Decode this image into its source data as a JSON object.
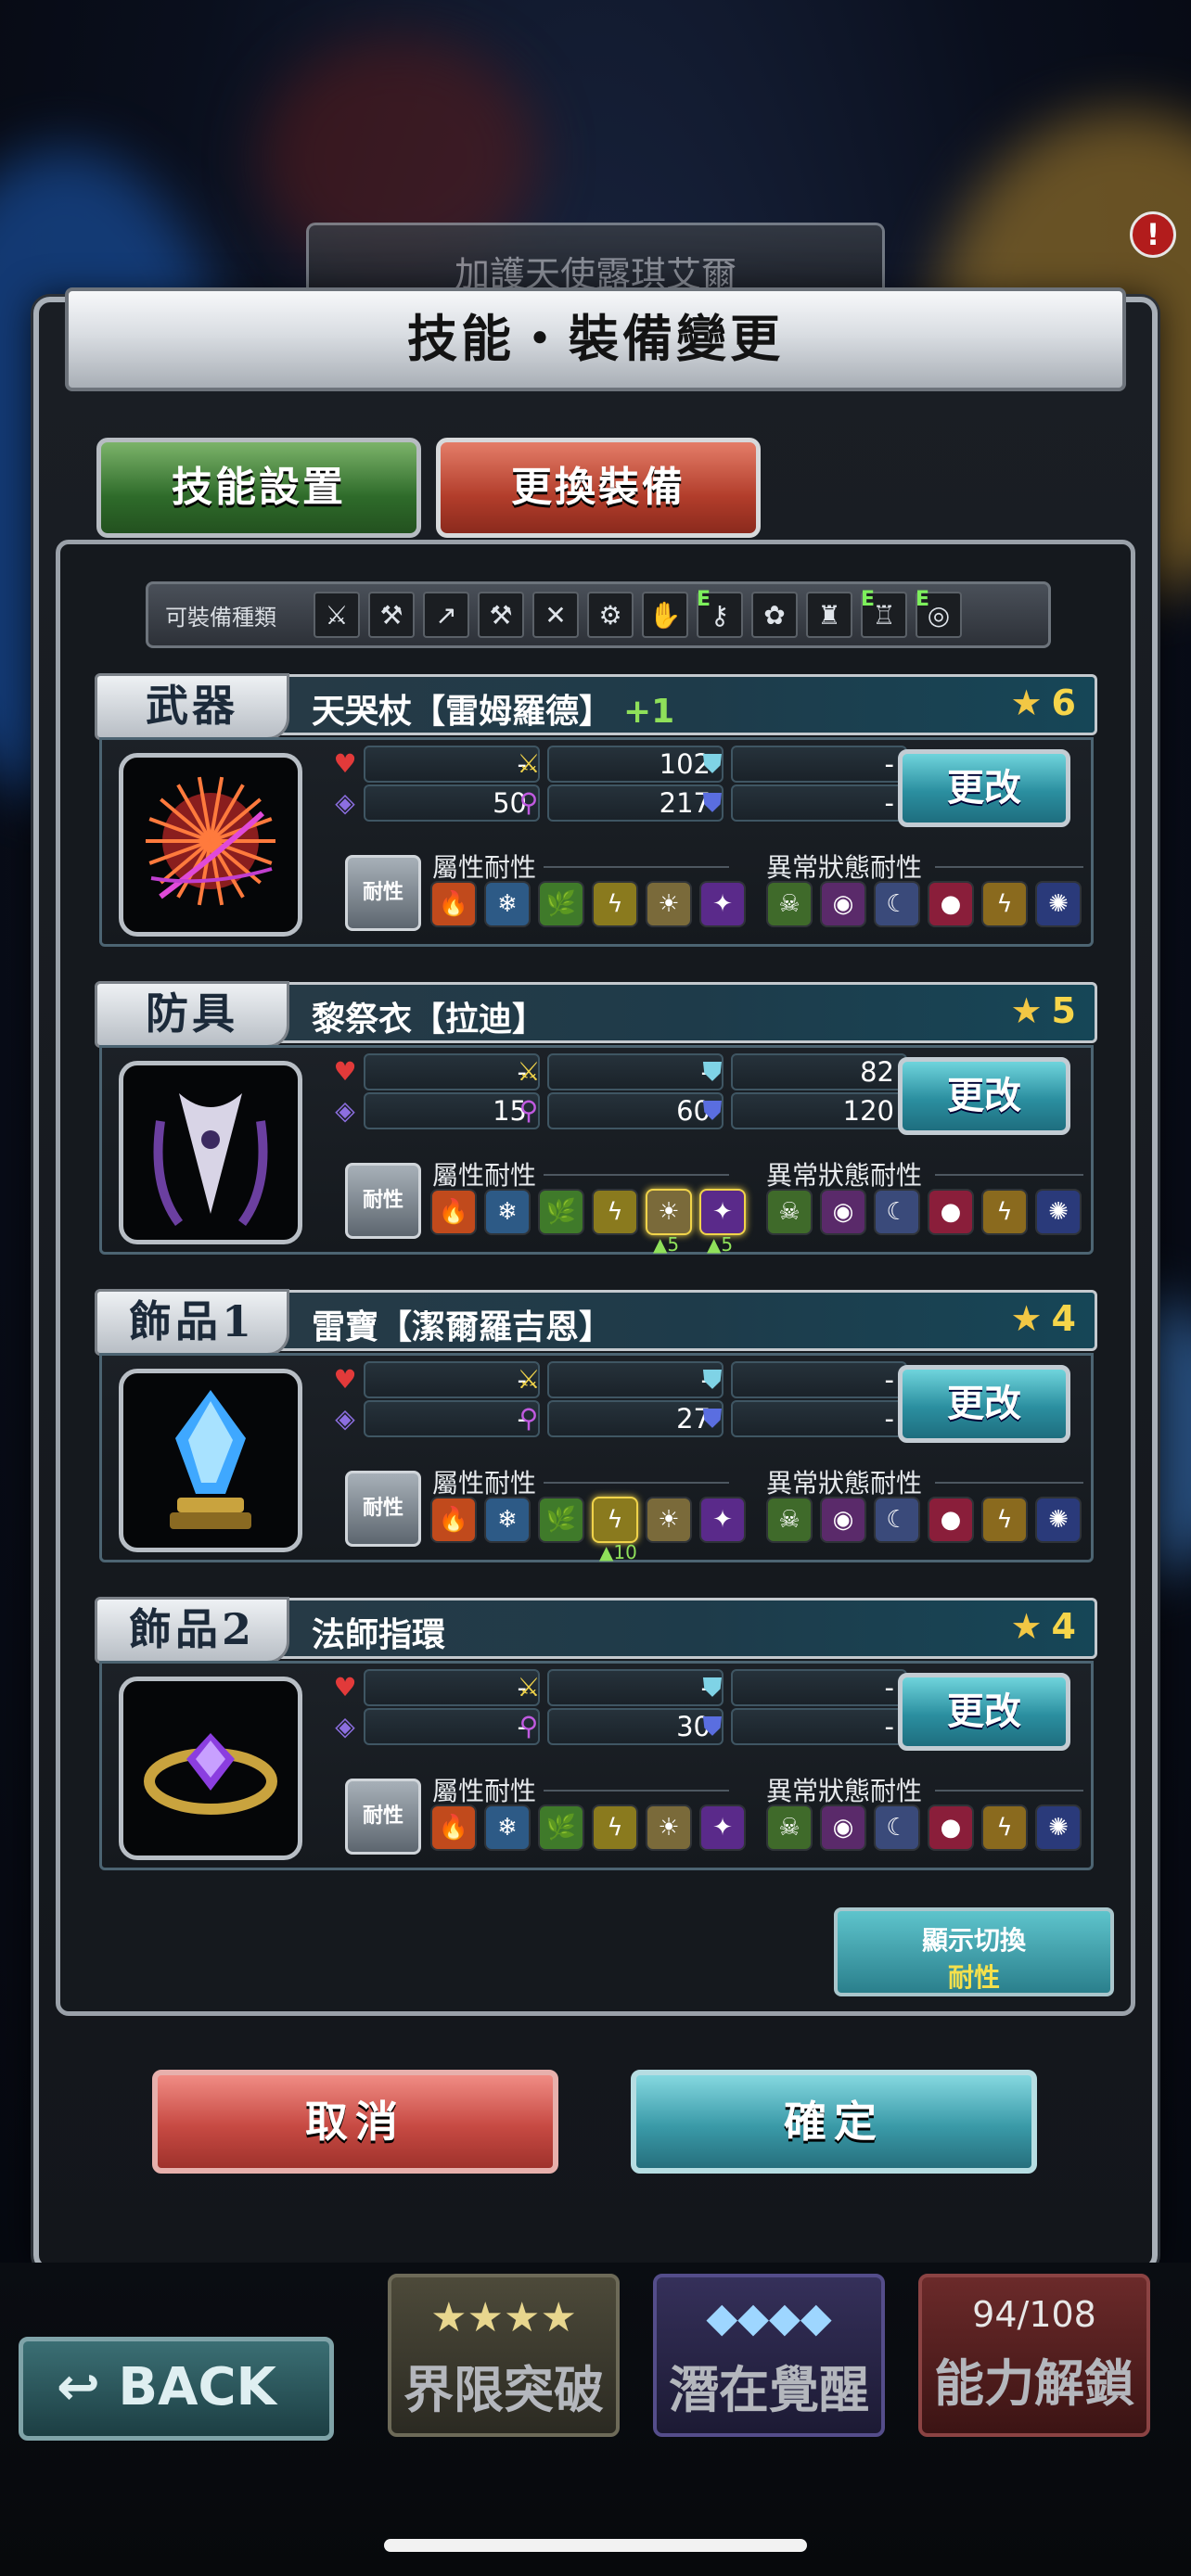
{
  "header": {
    "character_name": "加護天使露琪艾爾",
    "dialog_title": "技能・裝備變更",
    "alert": "!"
  },
  "tabs": {
    "skill": "技能設置",
    "equip": "更換裝備"
  },
  "equip_types": {
    "label": "可裝備種類",
    "icons": [
      "sword-icon",
      "axe-icon",
      "spear-icon",
      "hammer-icon",
      "bow-icon",
      "gear-icon",
      "claw-icon",
      "staff-icon",
      "flower-icon",
      "armor-icon",
      "robe-icon",
      "ring-icon"
    ]
  },
  "resist_labels": {
    "badge": "耐性",
    "element": "屬性耐性",
    "status": "異常狀態耐性"
  },
  "change_label": "更改",
  "slots": [
    {
      "tag": "武器",
      "name": "天哭杖【雷姆羅德】",
      "plus": "+1",
      "stars": "6",
      "hp": "-",
      "atk": "102",
      "def": "-",
      "mag": "50",
      "mp": "217",
      "spr": "-",
      "element_levels": {}
    },
    {
      "tag": "防具",
      "name": "黎祭衣【拉迪】",
      "plus": "",
      "stars": "5",
      "hp": "-",
      "atk": "-",
      "def": "82",
      "mag": "15",
      "mp": "60",
      "spr": "120",
      "element_levels": {
        "4": "▲5",
        "5": "▲5"
      }
    },
    {
      "tag": "飾品1",
      "name": "雷寶【潔爾羅吉恩】",
      "plus": "",
      "stars": "4",
      "hp": "-",
      "atk": "-",
      "def": "-",
      "mag": "-",
      "mp": "27",
      "spr": "-",
      "element_levels": {
        "3": "▲10"
      }
    },
    {
      "tag": "飾品2",
      "name": "法師指環",
      "plus": "",
      "stars": "4",
      "hp": "-",
      "atk": "-",
      "def": "-",
      "mag": "-",
      "mp": "30",
      "spr": "-",
      "element_levels": {}
    }
  ],
  "display_toggle": {
    "line1": "顯示切換",
    "line2": "耐性"
  },
  "buttons": {
    "cancel": "取消",
    "confirm": "確定",
    "back": "BACK"
  },
  "bottom_nav": [
    {
      "top": "★★★★",
      "label": "界限突破"
    },
    {
      "top": "◆◆◆◆",
      "label": "潛在覺醒"
    },
    {
      "top": "94/108",
      "label": "能力解鎖"
    }
  ],
  "colors": {
    "accent_cyan": "#2b8fa0",
    "cancel_red": "#c74a43",
    "plus_green": "#8fe05a",
    "star_gold": "#f2c744"
  }
}
